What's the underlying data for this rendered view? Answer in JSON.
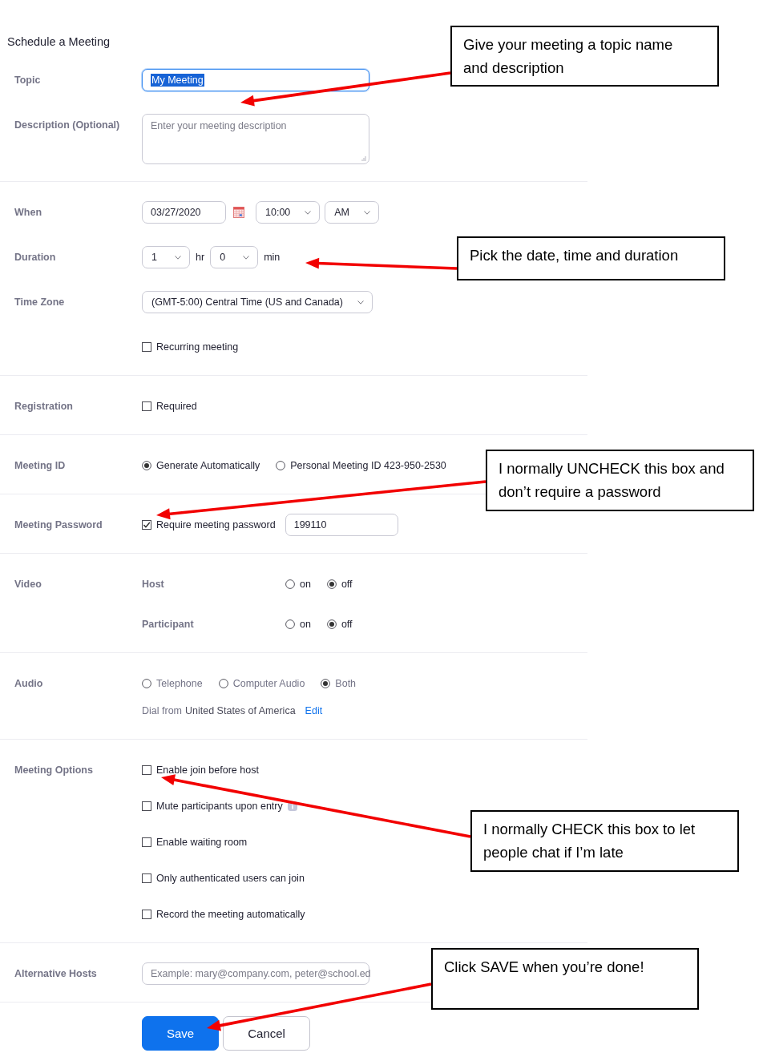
{
  "page": {
    "title": "Schedule a Meeting"
  },
  "sections": [
    {
      "rows": [
        {
          "label": "Topic",
          "lines": [
            [
              {
                "kind": "text",
                "value": "My Meeting",
                "focused": true
              }
            ]
          ]
        },
        {
          "label": "Description (Optional)",
          "lines": [
            [
              {
                "kind": "textarea",
                "placeholder": "Enter your meeting description"
              }
            ]
          ]
        }
      ]
    },
    {
      "rows": [
        {
          "label": "When",
          "lines": [
            [
              {
                "kind": "date",
                "value": "03/27/2020"
              },
              {
                "kind": "select",
                "value": "10:00"
              },
              {
                "kind": "select",
                "value": "AM"
              }
            ]
          ]
        },
        {
          "label": "Duration",
          "lines": [
            [
              {
                "kind": "select",
                "value": "1"
              },
              {
                "kind": "unit",
                "text": "hr"
              },
              {
                "kind": "select",
                "value": "0"
              },
              {
                "kind": "unit",
                "text": "min"
              }
            ]
          ]
        },
        {
          "label": "Time Zone",
          "lines": [
            [
              {
                "kind": "select",
                "value": "(GMT-5:00) Central Time (US and Canada)"
              }
            ]
          ]
        },
        {
          "lines": [
            [
              {
                "kind": "checkbox",
                "label": "Recurring meeting",
                "checked": false
              }
            ]
          ]
        }
      ]
    },
    {
      "rows": [
        {
          "label": "Registration",
          "lines": [
            [
              {
                "kind": "checkbox",
                "label": "Required",
                "checked": false
              }
            ]
          ]
        }
      ]
    },
    {
      "rows": [
        {
          "label": "Meeting ID",
          "lines": [
            [
              {
                "kind": "radio",
                "label": "Generate Automatically",
                "selected": true
              },
              {
                "kind": "radio",
                "label": "Personal Meeting ID 423-950-2530",
                "selected": false
              }
            ]
          ]
        }
      ]
    },
    {
      "rows": [
        {
          "label": "Meeting Password",
          "lines": [
            [
              {
                "kind": "checkbox",
                "label": "Require meeting password",
                "checked": true
              },
              {
                "kind": "text",
                "value": "199110",
                "focused": false
              }
            ]
          ]
        }
      ]
    },
    {
      "rows": [
        {
          "label": "Video",
          "lines": [
            [
              {
                "kind": "sublabel",
                "text": "Host"
              },
              {
                "kind": "radio",
                "label": "on",
                "selected": false
              },
              {
                "kind": "radio",
                "label": "off",
                "selected": true
              }
            ],
            [
              {
                "kind": "sublabel",
                "text": "Participant"
              },
              {
                "kind": "radio",
                "label": "on",
                "selected": false
              },
              {
                "kind": "radio",
                "label": "off",
                "selected": true
              }
            ]
          ]
        }
      ]
    },
    {
      "rows": [
        {
          "label": "Audio",
          "lines": [
            [
              {
                "kind": "radio",
                "label": "Telephone",
                "selected": false
              },
              {
                "kind": "radio",
                "label": "Computer Audio",
                "selected": false
              },
              {
                "kind": "radio",
                "label": "Both",
                "selected": true
              }
            ],
            [
              {
                "kind": "note",
                "text": "Dial from"
              },
              {
                "kind": "value",
                "text": "United States of America"
              },
              {
                "kind": "link",
                "text": "Edit"
              }
            ]
          ]
        }
      ]
    },
    {
      "rows": [
        {
          "label": "Meeting Options",
          "lines": [
            [
              {
                "kind": "checkbox",
                "label": "Enable join before host",
                "checked": false
              }
            ],
            [
              {
                "kind": "checkbox",
                "label": "Mute participants upon entry",
                "checked": false,
                "help_icon": true
              }
            ],
            [
              {
                "kind": "checkbox",
                "label": "Enable waiting room",
                "checked": false
              }
            ],
            [
              {
                "kind": "checkbox",
                "label": "Only authenticated users can join",
                "checked": false
              }
            ],
            [
              {
                "kind": "checkbox",
                "label": "Record the meeting automatically",
                "checked": false
              }
            ]
          ]
        }
      ]
    },
    {
      "rows": [
        {
          "label": "Alternative Hosts",
          "lines": [
            [
              {
                "kind": "text",
                "placeholder": "Example: mary@company.com, peter@school.ed",
                "focused": false
              }
            ]
          ]
        }
      ]
    }
  ],
  "buttons": [
    {
      "label": "Save",
      "kind": "primary"
    },
    {
      "label": "Cancel",
      "kind": "secondary"
    }
  ],
  "annotations": [
    {
      "text": "Give your meeting a topic name and description"
    },
    {
      "text": "Pick the date, time and duration"
    },
    {
      "text": "I normally UNCHECK this box and don’t require a password"
    },
    {
      "text": "I normally CHECK this box to let people chat if I’m late"
    },
    {
      "text": "Click SAVE when you’re done!"
    }
  ]
}
